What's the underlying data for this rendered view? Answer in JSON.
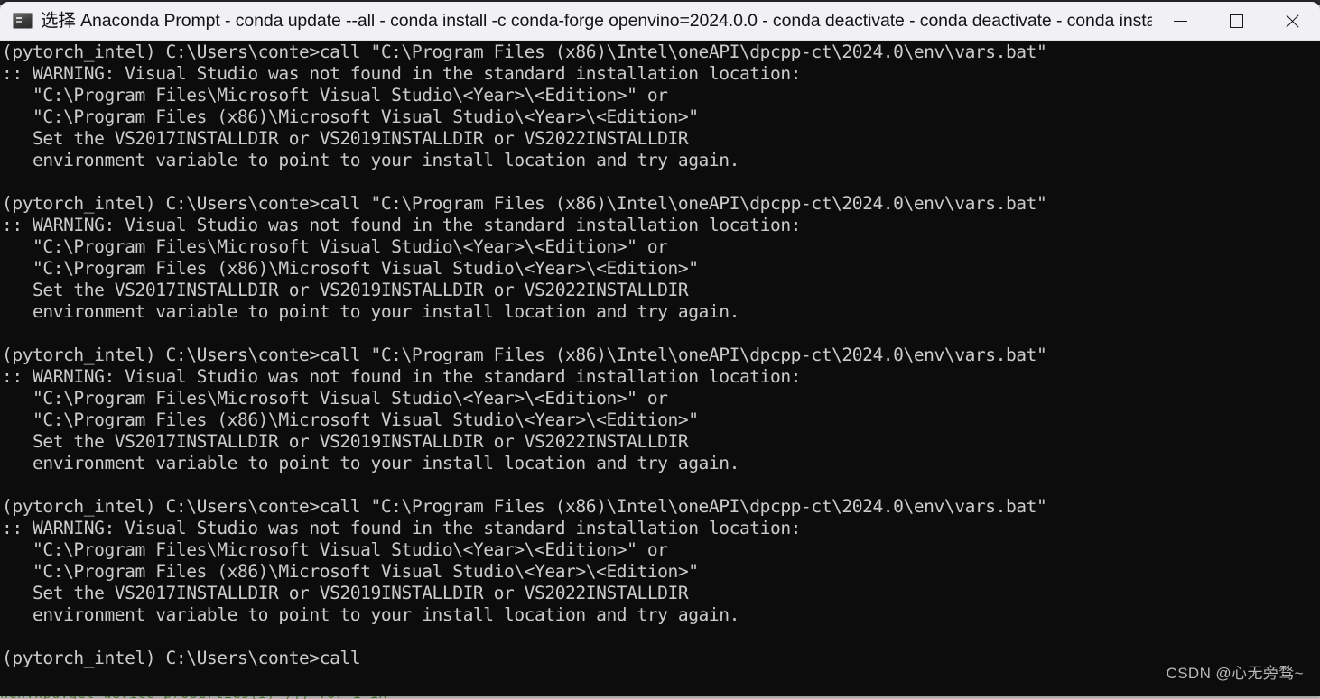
{
  "window": {
    "title": "选择 Anaconda Prompt - conda  update --all - conda  install -c conda-forge openvino=2024.0.0 - conda  deactivate - conda  deactivate - conda  install pk...",
    "icon": "console-icon",
    "controls": {
      "minimize_label": "—",
      "maximize_label": "☐",
      "close_label": "✕"
    },
    "titlebar_bg": "#f1f1f5",
    "console_bg": "#0c0c0c",
    "console_fg": "#cbcbcb"
  },
  "console": {
    "prompt_env": "(pytorch_intel)",
    "prompt_path": "C:\\Users\\conte>",
    "lines": [
      "(pytorch_intel) C:\\Users\\conte>call \"C:\\Program Files (x86)\\Intel\\oneAPI\\dpcpp-ct\\2024.0\\env\\vars.bat\"",
      ":: WARNING: Visual Studio was not found in the standard installation location:",
      "   \"C:\\Program Files\\Microsoft Visual Studio\\<Year>\\<Edition>\" or",
      "   \"C:\\Program Files (x86)\\Microsoft Visual Studio\\<Year>\\<Edition>\"",
      "   Set the VS2017INSTALLDIR or VS2019INSTALLDIR or VS2022INSTALLDIR",
      "   environment variable to point to your install location and try again.",
      "",
      "(pytorch_intel) C:\\Users\\conte>call \"C:\\Program Files (x86)\\Intel\\oneAPI\\dpcpp-ct\\2024.0\\env\\vars.bat\"",
      ":: WARNING: Visual Studio was not found in the standard installation location:",
      "   \"C:\\Program Files\\Microsoft Visual Studio\\<Year>\\<Edition>\" or",
      "   \"C:\\Program Files (x86)\\Microsoft Visual Studio\\<Year>\\<Edition>\"",
      "   Set the VS2017INSTALLDIR or VS2019INSTALLDIR or VS2022INSTALLDIR",
      "   environment variable to point to your install location and try again.",
      "",
      "(pytorch_intel) C:\\Users\\conte>call \"C:\\Program Files (x86)\\Intel\\oneAPI\\dpcpp-ct\\2024.0\\env\\vars.bat\"",
      ":: WARNING: Visual Studio was not found in the standard installation location:",
      "   \"C:\\Program Files\\Microsoft Visual Studio\\<Year>\\<Edition>\" or",
      "   \"C:\\Program Files (x86)\\Microsoft Visual Studio\\<Year>\\<Edition>\"",
      "   Set the VS2017INSTALLDIR or VS2019INSTALLDIR or VS2022INSTALLDIR",
      "   environment variable to point to your install location and try again.",
      "",
      "(pytorch_intel) C:\\Users\\conte>call \"C:\\Program Files (x86)\\Intel\\oneAPI\\dpcpp-ct\\2024.0\\env\\vars.bat\"",
      ":: WARNING: Visual Studio was not found in the standard installation location:",
      "   \"C:\\Program Files\\Microsoft Visual Studio\\<Year>\\<Edition>\" or",
      "   \"C:\\Program Files (x86)\\Microsoft Visual Studio\\<Year>\\<Edition>\"",
      "   Set the VS2017INSTALLDIR or VS2019INSTALLDIR or VS2022INSTALLDIR",
      "   environment variable to point to your install location and try again.",
      "",
      "(pytorch_intel) C:\\Users\\conte>call"
    ]
  },
  "watermark": {
    "text": "CSDN @心无旁骛~"
  },
  "background": {
    "partial_code_line": "nch.xpu.get_device_properties(i)\")]) for i in"
  }
}
